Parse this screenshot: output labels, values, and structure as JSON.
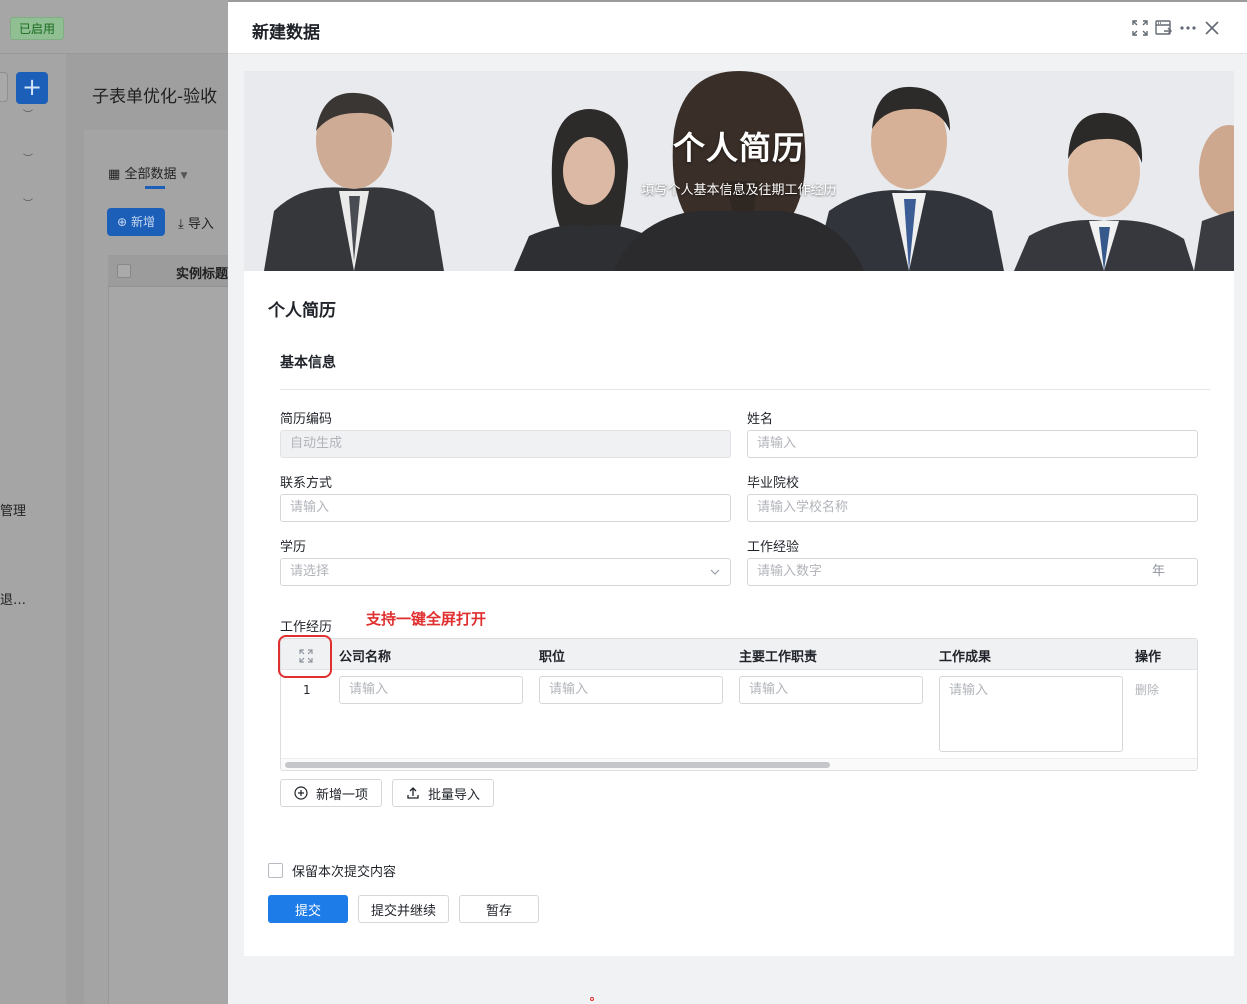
{
  "background": {
    "status_badge": "已启用",
    "page_title": "子表单优化-验收",
    "view_tab": "全部数据",
    "new_button": "新增",
    "import_button": "导入",
    "table_header": "实例标题",
    "side_item_1": "管理",
    "side_item_2": "退…"
  },
  "drawer": {
    "title": "新建数据"
  },
  "banner": {
    "title": "个人简历",
    "subtitle": "填写个人基本信息及往期工作经历"
  },
  "form": {
    "title": "个人简历",
    "section": "基本信息",
    "fields": {
      "resume_code": {
        "label": "简历编码",
        "placeholder": "自动生成"
      },
      "name": {
        "label": "姓名",
        "placeholder": "请输入"
      },
      "contact": {
        "label": "联系方式",
        "placeholder": "请输入"
      },
      "school": {
        "label": "毕业院校",
        "placeholder": "请输入学校名称"
      },
      "education": {
        "label": "学历",
        "placeholder": "请选择"
      },
      "experience": {
        "label": "工作经验",
        "placeholder": "请输入数字",
        "suffix": "年"
      }
    },
    "work_history": {
      "label": "工作经历",
      "note": "支持一键全屏打开",
      "columns": [
        "公司名称",
        "职位",
        "主要工作职责",
        "工作成果",
        "操作"
      ],
      "row_number": "1",
      "cell_placeholder": "请输入",
      "delete_label": "删除",
      "add_button": "新增一项",
      "batch_import_button": "批量导入"
    },
    "keep_content_label": "保留本次提交内容",
    "submit_button": "提交",
    "submit_continue_button": "提交并继续",
    "save_draft_button": "暂存"
  },
  "colors": {
    "primary": "#1e7ce8",
    "highlight": "#e02f2f"
  }
}
